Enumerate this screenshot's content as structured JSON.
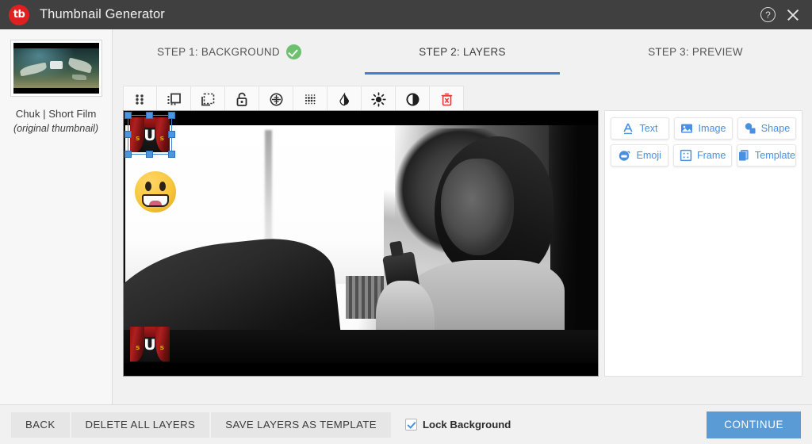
{
  "window": {
    "title": "Thumbnail Generator",
    "logo_text": "tb",
    "logo_color": "#e02020",
    "help_icon": "help-circle-icon",
    "close_icon": "close-icon"
  },
  "sidebar": {
    "thumbnail_title": "Chuk | Short Film",
    "thumbnail_subtitle": "(original thumbnail)"
  },
  "steps": [
    {
      "label": "STEP 1: BACKGROUND",
      "completed": true,
      "active": false
    },
    {
      "label": "STEP 2: LAYERS",
      "completed": false,
      "active": true
    },
    {
      "label": "STEP 3: PREVIEW",
      "completed": false,
      "active": false
    }
  ],
  "toolbar": [
    {
      "name": "move-grid-icon",
      "title": "Move"
    },
    {
      "name": "duplicate-layer-icon",
      "title": "Duplicate"
    },
    {
      "name": "select-layer-icon",
      "title": "Select"
    },
    {
      "name": "unlock-icon",
      "title": "Lock / Unlock"
    },
    {
      "name": "align-center-icon",
      "title": "Align"
    },
    {
      "name": "halftone-dots-icon",
      "title": "Pattern"
    },
    {
      "name": "water-drop-icon",
      "title": "Opacity"
    },
    {
      "name": "brightness-sun-icon",
      "title": "Brightness"
    },
    {
      "name": "contrast-icon",
      "title": "Contrast"
    },
    {
      "name": "delete-trash-icon",
      "title": "Delete Layer"
    }
  ],
  "add_panel": {
    "buttons": [
      {
        "label": "Text",
        "icon": "text-a-icon"
      },
      {
        "label": "Image",
        "icon": "image-picture-icon"
      },
      {
        "label": "Shape",
        "icon": "shapes-icon"
      },
      {
        "label": "Emoji",
        "icon": "emoji-face-icon"
      },
      {
        "label": "Frame",
        "icon": "frame-icon"
      },
      {
        "label": "Template",
        "icon": "template-layers-icon"
      }
    ],
    "accent_color": "#4a90e2"
  },
  "canvas": {
    "background_description": "Black and white film still of a girl holding a bottle near a bright window",
    "layers": [
      {
        "name": "curtain-u-logo-layer",
        "selected": true,
        "letter": "U"
      },
      {
        "name": "smiley-emoji-layer",
        "selected": false
      },
      {
        "name": "curtain-u-logo-layer-2",
        "selected": false,
        "letter": "U"
      }
    ],
    "selection_color": "#4e95e0"
  },
  "footer": {
    "back_label": "BACK",
    "delete_all_label": "DELETE ALL LAYERS",
    "save_template_label": "SAVE LAYERS AS TEMPLATE",
    "lock_background_label": "Lock Background",
    "lock_background_checked": true,
    "continue_label": "CONTINUE",
    "continue_color": "#5b9bd5"
  }
}
